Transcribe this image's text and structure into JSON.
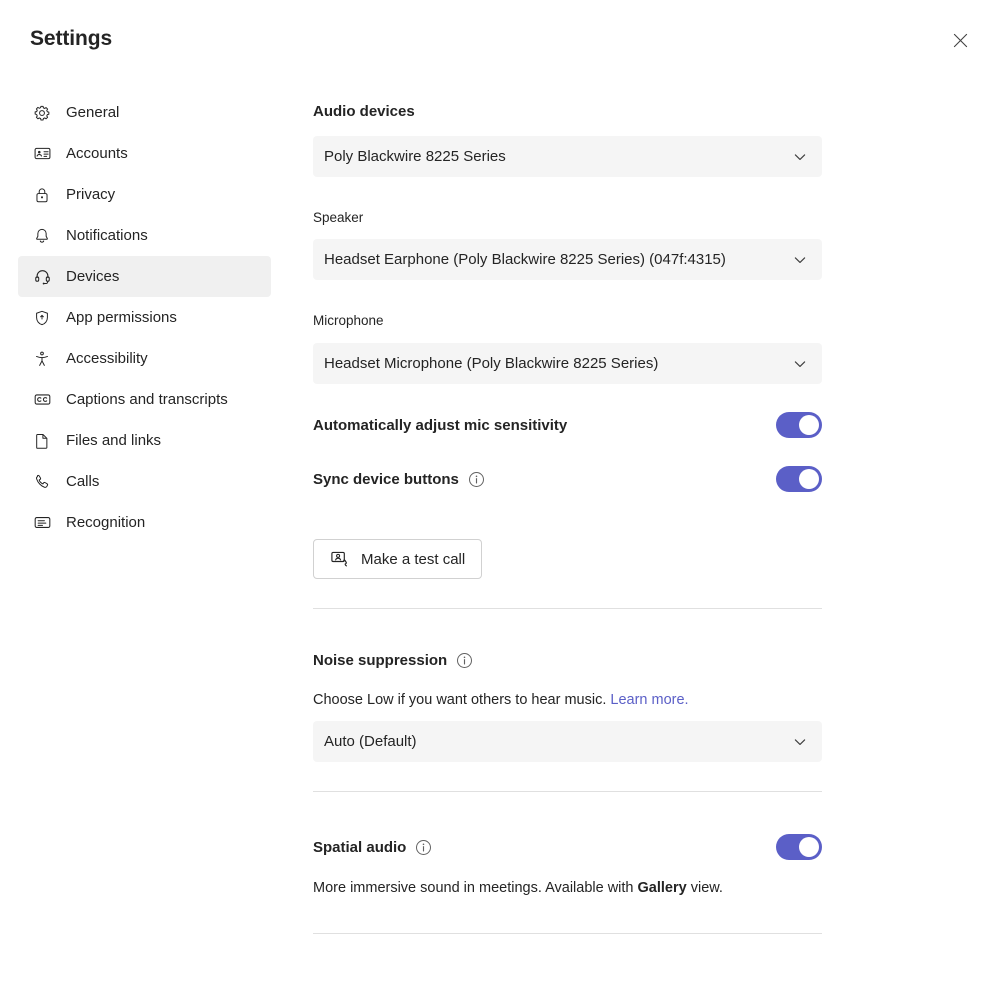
{
  "window": {
    "title": "Settings",
    "close_label": "Close"
  },
  "colors": {
    "accent": "#5b5fc7",
    "field_background": "#f5f5f5",
    "selected_nav_background": "#f0f0f0",
    "divider": "#e0e0e0",
    "text": "#242424"
  },
  "sidebar": {
    "items": [
      {
        "label": "General",
        "icon": "gear-icon",
        "selected": false
      },
      {
        "label": "Accounts",
        "icon": "id-card-icon",
        "selected": false
      },
      {
        "label": "Privacy",
        "icon": "lock-icon",
        "selected": false
      },
      {
        "label": "Notifications",
        "icon": "bell-icon",
        "selected": false
      },
      {
        "label": "Devices",
        "icon": "headset-icon",
        "selected": true
      },
      {
        "label": "App permissions",
        "icon": "shield-icon",
        "selected": false
      },
      {
        "label": "Accessibility",
        "icon": "accessibility-icon",
        "selected": false
      },
      {
        "label": "Captions and transcripts",
        "icon": "cc-icon",
        "selected": false
      },
      {
        "label": "Files and links",
        "icon": "document-icon",
        "selected": false
      },
      {
        "label": "Calls",
        "icon": "phone-icon",
        "selected": false
      },
      {
        "label": "Recognition",
        "icon": "recognition-icon",
        "selected": false
      }
    ]
  },
  "main": {
    "audio_devices": {
      "title": "Audio devices",
      "device_value": "Poly Blackwire 8225 Series",
      "speaker_label": "Speaker",
      "speaker_value": "Headset Earphone (Poly Blackwire 8225 Series) (047f:4315)",
      "microphone_label": "Microphone",
      "microphone_value": "Headset Microphone (Poly Blackwire 8225 Series)"
    },
    "auto_adjust_mic": {
      "label": "Automatically adjust mic sensitivity",
      "state": "on"
    },
    "sync_device_buttons": {
      "label": "Sync device buttons",
      "info_icon": "info-icon",
      "state": "on"
    },
    "test_call": {
      "label": "Make a test call",
      "icon": "video-person-call-icon"
    },
    "noise_suppression": {
      "title": "Noise suppression",
      "info_icon": "info-icon",
      "help_text": "Choose Low if you want others to hear music.",
      "link_text": "Learn more.",
      "value": "Auto (Default)"
    },
    "spatial_audio": {
      "title": "Spatial audio",
      "info_icon": "info-icon",
      "state": "on",
      "help_prefix": "More immersive sound in meetings. Available with ",
      "help_bold": "Gallery",
      "help_suffix": " view."
    }
  }
}
